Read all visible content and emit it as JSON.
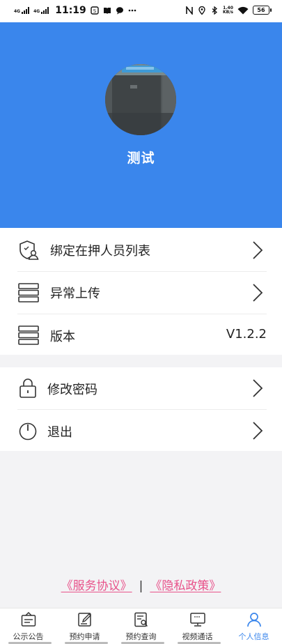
{
  "status_bar": {
    "net1": "4G",
    "net2": "4G",
    "time": "11:19",
    "speed_value": "1.40",
    "speed_unit": "KB/s",
    "battery": "56"
  },
  "profile": {
    "name": "测试"
  },
  "menu": {
    "bind_list": "绑定在押人员列表",
    "upload_error": "异常上传",
    "version_label": "版本",
    "version_value": "V1.2.2",
    "change_password": "修改密码",
    "logout": "退出"
  },
  "footer": {
    "service_agreement": "《服务协议》",
    "separator": "|",
    "privacy_policy": "《隐私政策》"
  },
  "tabs": [
    {
      "label": "公示公告",
      "icon": "bulletin-icon"
    },
    {
      "label": "预约申请",
      "icon": "edit-form-icon"
    },
    {
      "label": "预约查询",
      "icon": "document-search-icon"
    },
    {
      "label": "视频通话",
      "icon": "monitor-icon"
    },
    {
      "label": "个人信息",
      "icon": "person-icon"
    }
  ],
  "colors": {
    "primary": "#3a86ec",
    "link": "#e8528a"
  }
}
